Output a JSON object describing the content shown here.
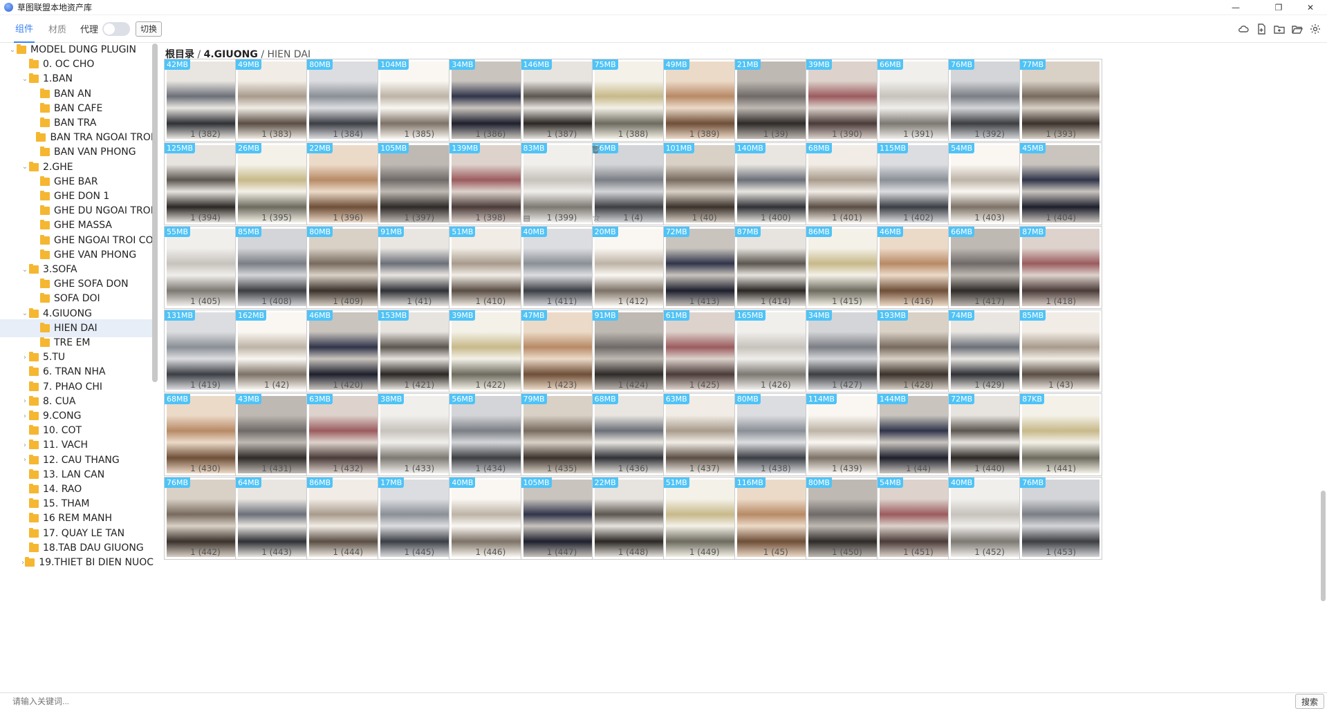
{
  "window": {
    "title": "草图联盟本地资产库",
    "controls": [
      "minimize",
      "maximize",
      "close"
    ]
  },
  "toolbar": {
    "tabs": [
      "组件",
      "材质"
    ],
    "active_tab": "组件",
    "proxy_label": "代理",
    "proxy_on": false,
    "switch_label": "切换",
    "icons": [
      "cloud-icon",
      "add-file-icon",
      "add-folder-icon",
      "open-folder-icon",
      "settings-icon"
    ]
  },
  "tree": [
    {
      "label": "MODEL DUNG PLUGIN",
      "level": 0,
      "caret": "down"
    },
    {
      "label": "0. OC CHO",
      "level": 1,
      "caret": ""
    },
    {
      "label": "1.BAN",
      "level": 1,
      "caret": "down"
    },
    {
      "label": "BAN AN",
      "level": 2,
      "caret": ""
    },
    {
      "label": "BAN CAFE",
      "level": 2,
      "caret": ""
    },
    {
      "label": "BAN TRA",
      "level": 2,
      "caret": ""
    },
    {
      "label": "BAN TRA NGOAI TROI",
      "level": 2,
      "caret": ""
    },
    {
      "label": "BAN VAN PHONG",
      "level": 2,
      "caret": ""
    },
    {
      "label": "2.GHE",
      "level": 1,
      "caret": "down"
    },
    {
      "label": "GHE BAR",
      "level": 2,
      "caret": ""
    },
    {
      "label": "GHE DON 1",
      "level": 2,
      "caret": ""
    },
    {
      "label": "GHE DU NGOAI TROI",
      "level": 2,
      "caret": ""
    },
    {
      "label": "GHE MASSA",
      "level": 2,
      "caret": ""
    },
    {
      "label": "GHE NGOAI TROI CO",
      "level": 2,
      "caret": ""
    },
    {
      "label": "GHE VAN PHONG",
      "level": 2,
      "caret": ""
    },
    {
      "label": "3.SOFA",
      "level": 1,
      "caret": "down"
    },
    {
      "label": "GHE SOFA DON",
      "level": 2,
      "caret": ""
    },
    {
      "label": "SOFA DOI",
      "level": 2,
      "caret": ""
    },
    {
      "label": "4.GIUONG",
      "level": 1,
      "caret": "down"
    },
    {
      "label": "HIEN DAI",
      "level": 2,
      "caret": "",
      "selected": true
    },
    {
      "label": "TRE EM",
      "level": 2,
      "caret": ""
    },
    {
      "label": "5.TU",
      "level": 1,
      "caret": "right"
    },
    {
      "label": "6. TRAN NHA",
      "level": 1,
      "caret": ""
    },
    {
      "label": "7. PHAO CHI",
      "level": 1,
      "caret": ""
    },
    {
      "label": "8. CUA",
      "level": 1,
      "caret": "right"
    },
    {
      "label": "9.CONG",
      "level": 1,
      "caret": "right"
    },
    {
      "label": "10. COT",
      "level": 1,
      "caret": ""
    },
    {
      "label": "11. VACH",
      "level": 1,
      "caret": "right"
    },
    {
      "label": "12. CAU THANG",
      "level": 1,
      "caret": "right"
    },
    {
      "label": "13. LAN CAN",
      "level": 1,
      "caret": ""
    },
    {
      "label": "14. RAO",
      "level": 1,
      "caret": ""
    },
    {
      "label": "15. THAM",
      "level": 1,
      "caret": ""
    },
    {
      "label": "16 REM MANH",
      "level": 1,
      "caret": ""
    },
    {
      "label": "17. QUAY LE TAN",
      "level": 1,
      "caret": ""
    },
    {
      "label": "18.TAB DAU GIUONG",
      "level": 1,
      "caret": ""
    },
    {
      "label": "19.THIET BI DIEN NUOC",
      "level": 1,
      "caret": "right"
    }
  ],
  "breadcrumb": {
    "root": "根目录",
    "sep": " / ",
    "parent": "4.GIUONG",
    "current": "HIEN DAI"
  },
  "assets": [
    [
      {
        "size": "42MB",
        "name": "1 (382)"
      },
      {
        "size": "49MB",
        "name": "1 (383)"
      },
      {
        "size": "80MB",
        "name": "1 (384)"
      },
      {
        "size": "104MB",
        "name": "1 (385)"
      },
      {
        "size": "34MB",
        "name": "1 (386)"
      },
      {
        "size": "146MB",
        "name": "1 (387)"
      },
      {
        "size": "75MB",
        "name": "1 (388)"
      },
      {
        "size": "49MB",
        "name": "1 (389)"
      },
      {
        "size": "21MB",
        "name": "1 (39)"
      },
      {
        "size": "39MB",
        "name": "1 (390)"
      },
      {
        "size": "66MB",
        "name": "1 (391)"
      },
      {
        "size": "76MB",
        "name": "1 (392)"
      },
      {
        "size": "77MB",
        "name": "1 (393)"
      }
    ],
    [
      {
        "size": "125MB",
        "name": "1 (394)"
      },
      {
        "size": "26MB",
        "name": "1 (395)"
      },
      {
        "size": "22MB",
        "name": "1 (396)"
      },
      {
        "size": "105MB",
        "name": "1 (397)"
      },
      {
        "size": "139MB",
        "name": "1 (398)"
      },
      {
        "size": "83MB",
        "name": "1 (399)",
        "hover": true
      },
      {
        "size": "36MB",
        "name": "1 (4)"
      },
      {
        "size": "101MB",
        "name": "1 (40)"
      },
      {
        "size": "140MB",
        "name": "1 (400)"
      },
      {
        "size": "68MB",
        "name": "1 (401)"
      },
      {
        "size": "115MB",
        "name": "1 (402)"
      },
      {
        "size": "54MB",
        "name": "1 (403)"
      },
      {
        "size": "45MB",
        "name": "1 (404)"
      }
    ],
    [
      {
        "size": "55MB",
        "name": "1 (405)"
      },
      {
        "size": "85MB",
        "name": "1 (408)"
      },
      {
        "size": "80MB",
        "name": "1 (409)"
      },
      {
        "size": "91MB",
        "name": "1 (41)"
      },
      {
        "size": "51MB",
        "name": "1 (410)"
      },
      {
        "size": "40MB",
        "name": "1 (411)"
      },
      {
        "size": "20MB",
        "name": "1 (412)"
      },
      {
        "size": "72MB",
        "name": "1 (413)"
      },
      {
        "size": "87MB",
        "name": "1 (414)"
      },
      {
        "size": "86MB",
        "name": "1 (415)"
      },
      {
        "size": "46MB",
        "name": "1 (416)"
      },
      {
        "size": "66MB",
        "name": "1 (417)"
      },
      {
        "size": "87MB",
        "name": "1 (418)"
      }
    ],
    [
      {
        "size": "131MB",
        "name": "1 (419)"
      },
      {
        "size": "162MB",
        "name": "1 (42)"
      },
      {
        "size": "46MB",
        "name": "1 (420)"
      },
      {
        "size": "153MB",
        "name": "1 (421)"
      },
      {
        "size": "39MB",
        "name": "1 (422)"
      },
      {
        "size": "47MB",
        "name": "1 (423)"
      },
      {
        "size": "91MB",
        "name": "1 (424)"
      },
      {
        "size": "61MB",
        "name": "1 (425)"
      },
      {
        "size": "165MB",
        "name": "1 (426)"
      },
      {
        "size": "34MB",
        "name": "1 (427)"
      },
      {
        "size": "193MB",
        "name": "1 (428)"
      },
      {
        "size": "74MB",
        "name": "1 (429)"
      },
      {
        "size": "85MB",
        "name": "1 (43)"
      }
    ],
    [
      {
        "size": "68MB",
        "name": "1 (430)"
      },
      {
        "size": "43MB",
        "name": "1 (431)"
      },
      {
        "size": "63MB",
        "name": "1 (432)"
      },
      {
        "size": "38MB",
        "name": "1 (433)"
      },
      {
        "size": "56MB",
        "name": "1 (434)"
      },
      {
        "size": "79MB",
        "name": "1 (435)"
      },
      {
        "size": "68MB",
        "name": "1 (436)"
      },
      {
        "size": "63MB",
        "name": "1 (437)"
      },
      {
        "size": "80MB",
        "name": "1 (438)"
      },
      {
        "size": "114MB",
        "name": "1 (439)"
      },
      {
        "size": "144MB",
        "name": "1 (44)"
      },
      {
        "size": "72MB",
        "name": "1 (440)"
      },
      {
        "size": "87KB",
        "name": "1 (441)"
      }
    ],
    [
      {
        "size": "76MB",
        "name": "1 (442)"
      },
      {
        "size": "64MB",
        "name": "1 (443)"
      },
      {
        "size": "86MB",
        "name": "1 (444)"
      },
      {
        "size": "17MB",
        "name": "1 (445)"
      },
      {
        "size": "40MB",
        "name": "1 (446)"
      },
      {
        "size": "105MB",
        "name": "1 (447)"
      },
      {
        "size": "22MB",
        "name": "1 (448)"
      },
      {
        "size": "51MB",
        "name": "1 (449)"
      },
      {
        "size": "116MB",
        "name": "1 (45)"
      },
      {
        "size": "80MB",
        "name": "1 (450)"
      },
      {
        "size": "54MB",
        "name": "1 (451)"
      },
      {
        "size": "40MB",
        "name": "1 (452)"
      },
      {
        "size": "76MB",
        "name": "1 (453)"
      }
    ]
  ],
  "search": {
    "placeholder": "请输入关键词...",
    "button_label": "搜索"
  },
  "colors": {
    "accent": "#3b82f6",
    "size_badge": "#4fc3f7",
    "folder": "#f5b731",
    "selected_row": "#e8eef8"
  }
}
